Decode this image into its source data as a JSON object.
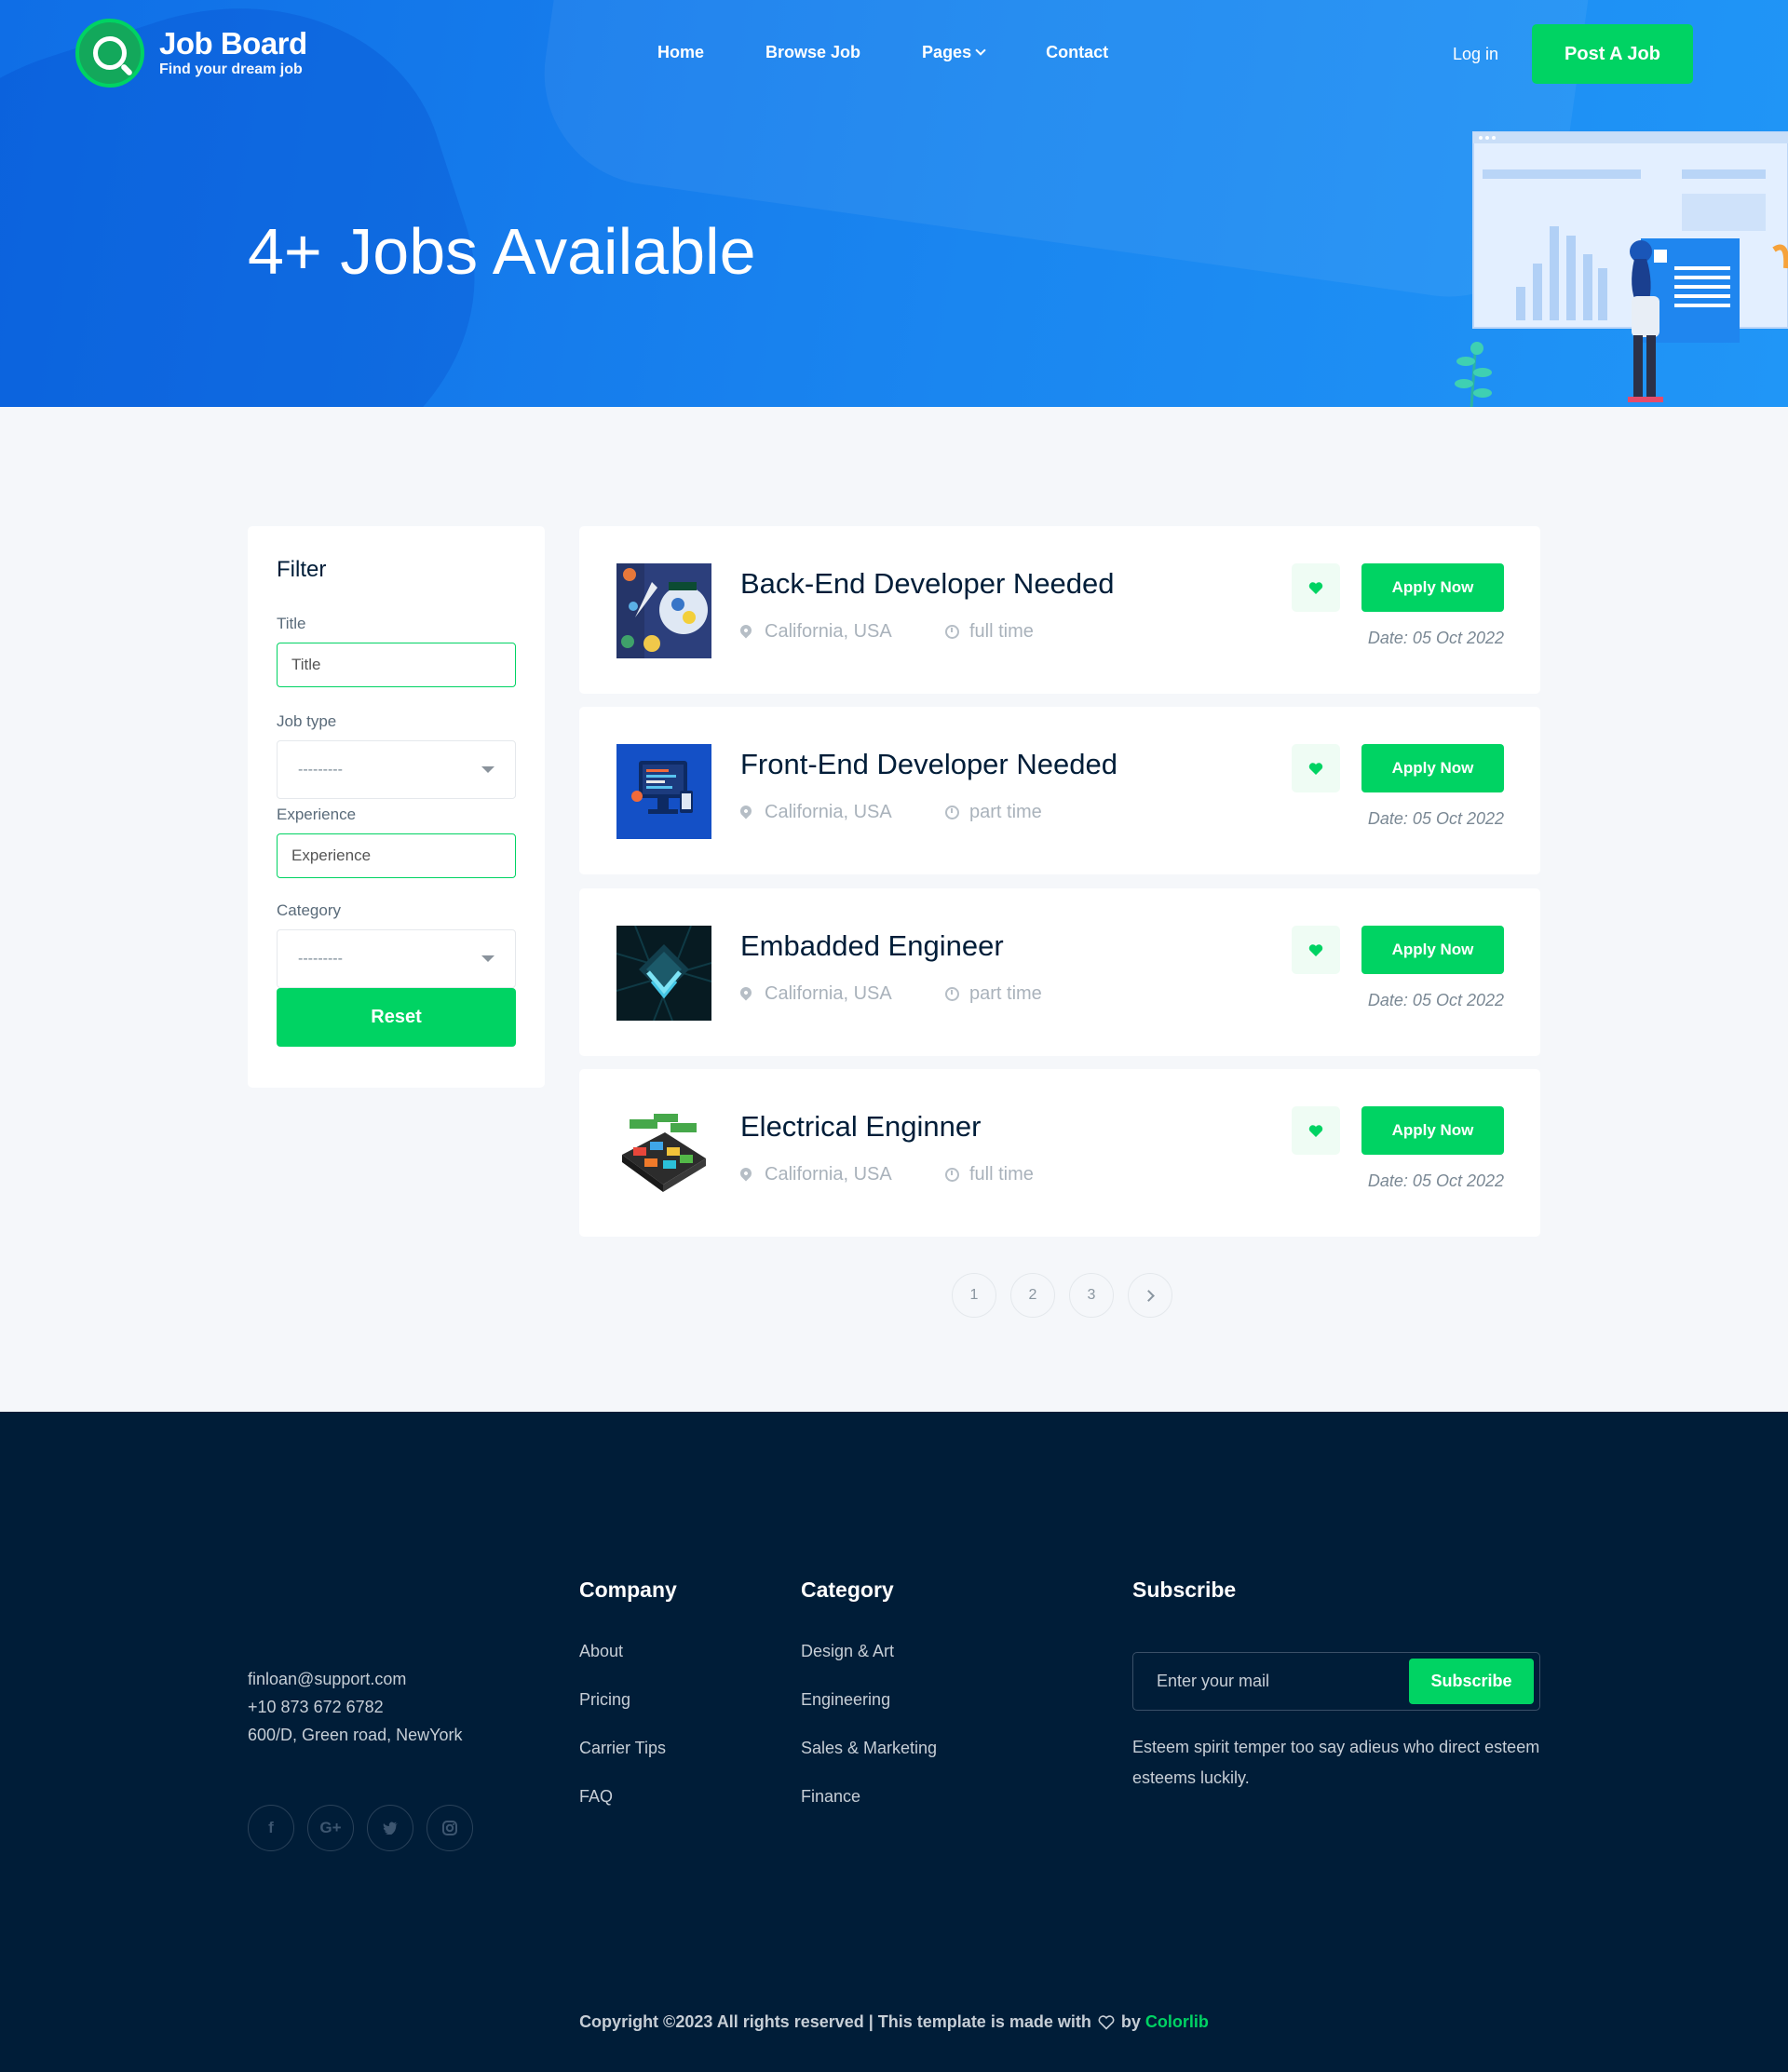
{
  "brand": {
    "title": "Job Board",
    "tagline": "Find your dream job"
  },
  "nav": {
    "items": [
      "Home",
      "Browse Job",
      "Pages",
      "Contact"
    ],
    "login": "Log in",
    "post_job": "Post A Job"
  },
  "hero": {
    "title": "4+ Jobs Available"
  },
  "filter": {
    "heading": "Filter",
    "title_label": "Title",
    "title_placeholder": "Title",
    "jobtype_label": "Job type",
    "jobtype_value": "---------",
    "experience_label": "Experience",
    "experience_placeholder": "Experience",
    "category_label": "Category",
    "category_value": "---------",
    "reset": "Reset"
  },
  "jobs": [
    {
      "title": "Back-End Developer Needed",
      "location": "California, USA",
      "type": "full time",
      "date": "Date: 05 Oct 2022",
      "apply": "Apply Now"
    },
    {
      "title": "Front-End Developer Needed",
      "location": "California, USA",
      "type": "part time",
      "date": "Date: 05 Oct 2022",
      "apply": "Apply Now"
    },
    {
      "title": "Embadded Engineer",
      "location": "California, USA",
      "type": "part time",
      "date": "Date: 05 Oct 2022",
      "apply": "Apply Now"
    },
    {
      "title": "Electrical Enginner",
      "location": "California, USA",
      "type": "full time",
      "date": "Date: 05 Oct 2022",
      "apply": "Apply Now"
    }
  ],
  "pagination": {
    "pages": [
      "1",
      "2",
      "3"
    ]
  },
  "footer": {
    "contact": {
      "email": "finloan@support.com",
      "phone": "+10 873 672 6782",
      "address": "600/D, Green road, NewYork"
    },
    "socials": [
      "f",
      "G+",
      "t",
      "ig"
    ],
    "company": {
      "heading": "Company",
      "links": [
        "About",
        "Pricing",
        "Carrier Tips",
        "FAQ"
      ]
    },
    "category": {
      "heading": "Category",
      "links": [
        "Design & Art",
        "Engineering",
        "Sales & Marketing",
        "Finance"
      ]
    },
    "subscribe": {
      "heading": "Subscribe",
      "placeholder": "Enter your mail",
      "button": "Subscribe",
      "text": "Esteem spirit temper too say adieus who direct esteem esteems luckily."
    },
    "copyright_prefix": "Copyright ©2023 All rights reserved | This template is made with",
    "copyright_by": "by",
    "copyright_brand": "Colorlib"
  },
  "colors": {
    "primary_blue": "#1a86f0",
    "accent_green": "#00d363",
    "footer_bg": "#001d38",
    "page_bg": "#f5f7fa"
  }
}
